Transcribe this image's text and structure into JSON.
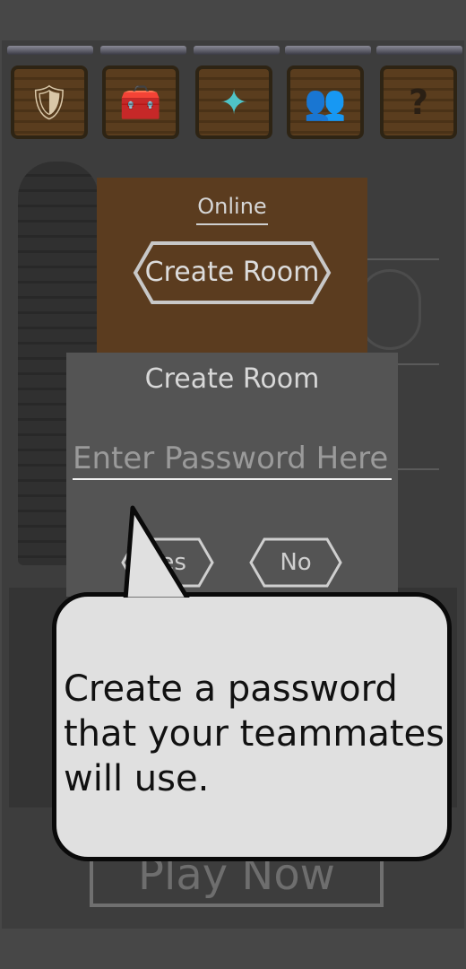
{
  "top_icons": [
    {
      "name": "shield-sword-icon",
      "glyph": "🛡"
    },
    {
      "name": "treasure-chest-icon",
      "glyph": "🧰"
    },
    {
      "name": "mage-figure-icon",
      "glyph": "✦"
    },
    {
      "name": "hooded-figures-icon",
      "glyph": "👥"
    },
    {
      "name": "question-mark-icon",
      "glyph": "?"
    }
  ],
  "online_panel": {
    "label": "Online",
    "create_room_button": "Create Room"
  },
  "create_room_dialog": {
    "title": "Create Room",
    "password_placeholder": "Enter Password Here",
    "yes_button": "Yes",
    "no_button": "No"
  },
  "tooltip": {
    "text": "Create a password that your teammates will use."
  },
  "background": {
    "play_now_button": "Play Now"
  },
  "colors": {
    "panel_brown": "#5b3c1f",
    "dialog_gray": "#545454",
    "bubble_fill": "#e0e0e0"
  }
}
